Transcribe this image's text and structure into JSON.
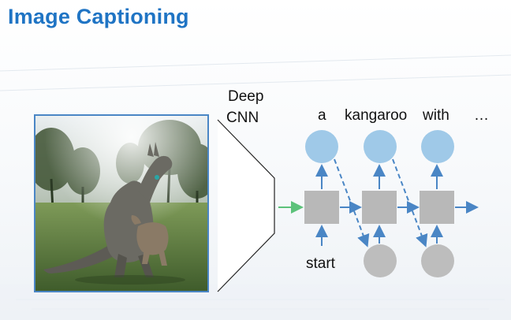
{
  "slide": {
    "title": "Image Captioning"
  },
  "cnn": {
    "label_line1": "Deep",
    "label_line2": "CNN"
  },
  "rnn": {
    "output_words": [
      "a",
      "kangaroo",
      "with",
      "…"
    ],
    "input_word": "start"
  },
  "colors": {
    "title": "#1f74c4",
    "output_node": "#9fc9e8",
    "hidden_node": "#b8b8b8",
    "input_node": "#bdbdbd",
    "arrow": "#4a86c5",
    "feature_arrow": "#5cc27a",
    "image_border": "#4a86c5"
  },
  "image": {
    "subject": "kangaroo with joey on grass field"
  }
}
